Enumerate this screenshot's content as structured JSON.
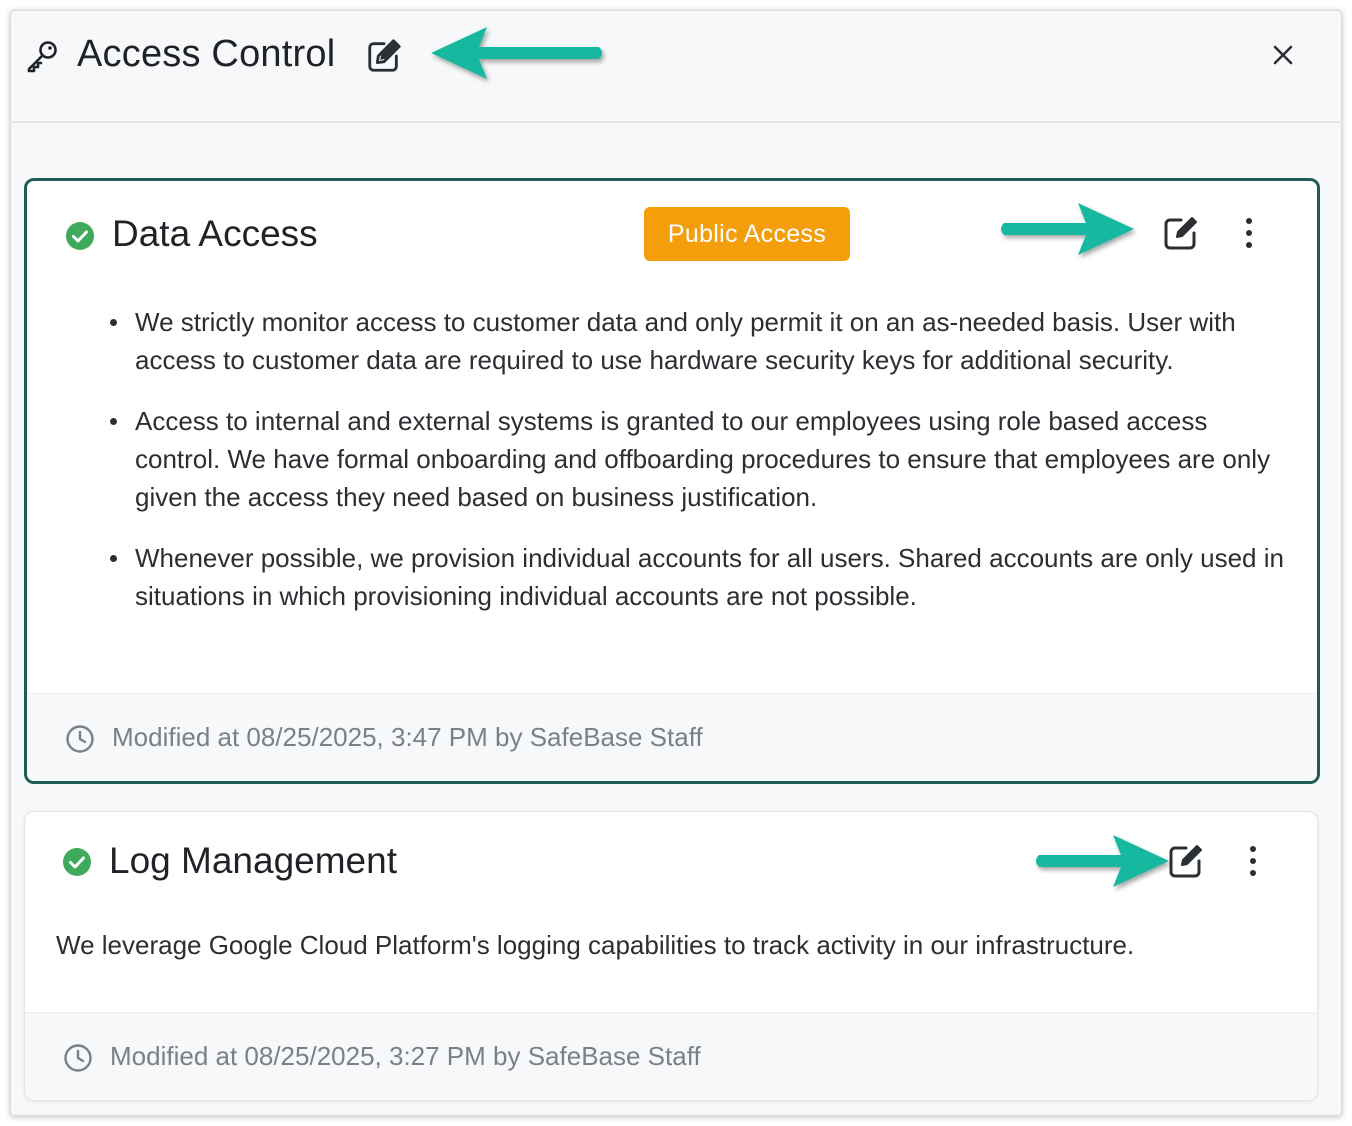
{
  "panel": {
    "title": "Access Control"
  },
  "cards": [
    {
      "title": "Data Access",
      "status": "complete",
      "badge": "Public Access",
      "bullets": [
        "We strictly monitor access to customer data and only permit it on an as-needed basis. User with access to customer data are required to use hardware security keys for additional security.",
        "Access to internal and external systems is granted to our employees using role based access control. We have formal onboarding and offboarding procedures to ensure that employees are only given the access they need based on business justification.",
        "Whenever possible, we provision individual accounts for all users. Shared accounts are only used in situations in which provisioning individual accounts are not possible."
      ],
      "modified": "Modified at 08/25/2025, 3:47 PM by SafeBase Staff"
    },
    {
      "title": "Log Management",
      "status": "complete",
      "description": "We leverage Google Cloud Platform's logging capabilities to track activity in our infrastructure.",
      "modified": "Modified at 08/25/2025, 3:27 PM by SafeBase Staff"
    }
  ],
  "colors": {
    "accent": "#1f5c57",
    "badge": "#f59e0b",
    "status_ok": "#3faa5b",
    "arrow": "#14b8a0"
  },
  "icons": {
    "header": [
      "key-icon",
      "edit-icon",
      "close-icon"
    ],
    "card": [
      "check-circle-icon",
      "edit-icon",
      "more-vertical-icon",
      "clock-icon"
    ]
  }
}
